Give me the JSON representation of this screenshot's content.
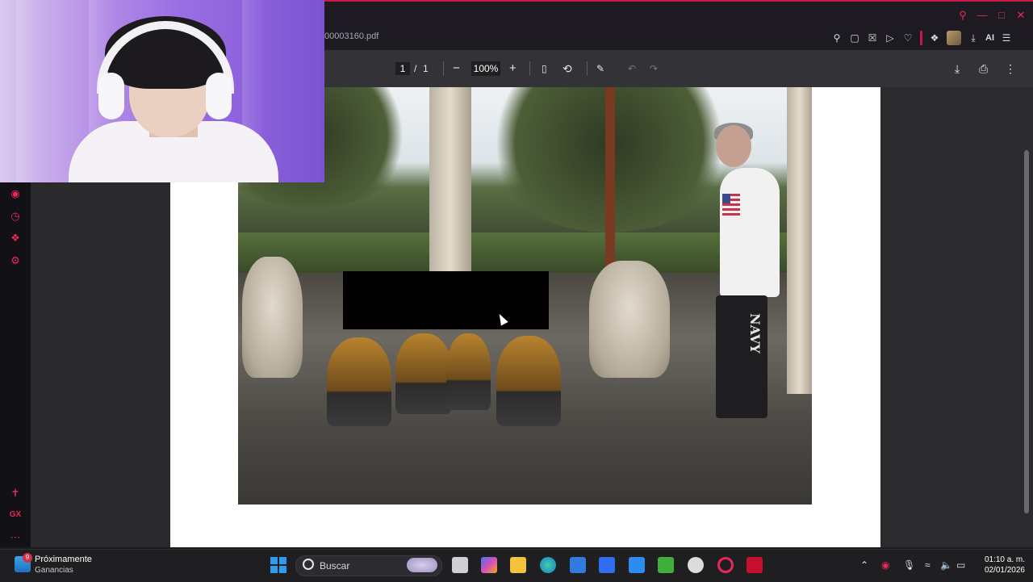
{
  "browser": {
    "tab_title": "00003160.pdf",
    "ai_label": "AI"
  },
  "pdf_toolbar": {
    "current_page": "1",
    "page_separator": "/",
    "total_pages": "1",
    "zoom": "100%",
    "zoom_out": "−",
    "zoom_in": "+"
  },
  "photo": {
    "shirt_text": "NAVY"
  },
  "taskbar": {
    "widget_title": "Próximamente",
    "widget_subtitle": "Ganancias",
    "widget_badge": "9",
    "search_placeholder": "Buscar",
    "time": "01:10 a. m.",
    "date": "02/01/2026"
  },
  "colors": {
    "accent": "#e8285a",
    "chrome_bg": "#1d1b21",
    "pdf_toolbar_bg": "#333337"
  }
}
